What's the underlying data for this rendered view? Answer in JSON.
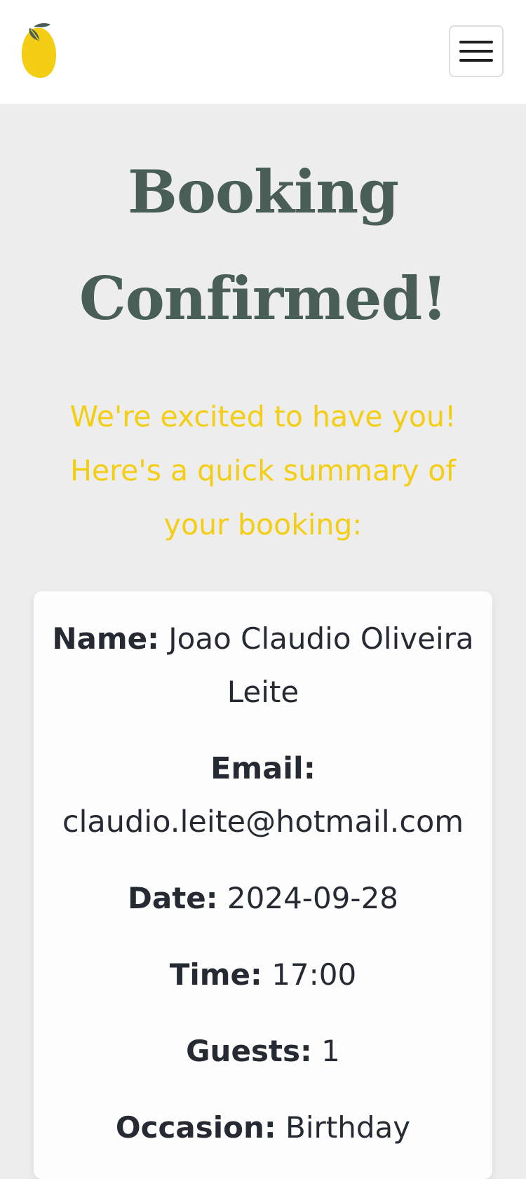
{
  "header": {
    "logo_icon": "lemon-icon",
    "menu_icon": "hamburger-menu-icon"
  },
  "main": {
    "title": "Booking Confirmed!",
    "subtitle": "We're excited to have you! Here's a quick summary of your booking:"
  },
  "booking": {
    "name_label": "Name:",
    "name_value": "Joao Claudio Oliveira Leite",
    "email_label": "Email:",
    "email_value": "claudio.leite@hotmail.com",
    "date_label": "Date:",
    "date_value": "2024-09-28",
    "time_label": "Time:",
    "time_value": "17:00",
    "guests_label": "Guests:",
    "guests_value": "1",
    "occasion_label": "Occasion:",
    "occasion_value": "Birthday"
  },
  "colors": {
    "primary_green": "#495e57",
    "primary_yellow": "#f4ce14",
    "background": "#ededed",
    "card": "#fdfdfd",
    "text_dark": "#262a33"
  }
}
